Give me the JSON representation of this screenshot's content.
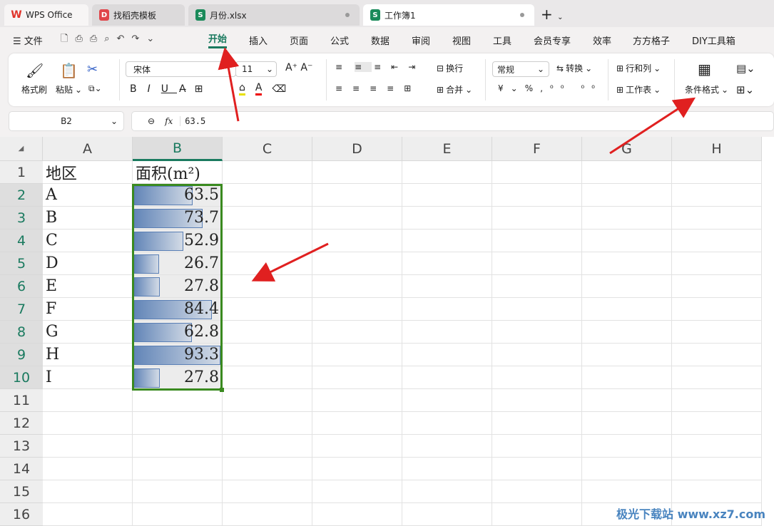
{
  "tabs": [
    {
      "label": "WPS Office"
    },
    {
      "label": "找稻壳模板"
    },
    {
      "label": "月份.xlsx"
    },
    {
      "label": "工作簿1"
    }
  ],
  "menu": {
    "file": "文件",
    "items": [
      "开始",
      "插入",
      "页面",
      "公式",
      "数据",
      "审阅",
      "视图",
      "工具",
      "会员专享",
      "效率",
      "方方格子",
      "DIY工具箱"
    ]
  },
  "ribbon": {
    "format_painter": "格式刷",
    "paste": "粘贴",
    "font": "宋体",
    "font_size": "11",
    "wrap": "换行",
    "merge": "合并",
    "number_format": "常规",
    "convert": "转换",
    "rows_cols": "行和列",
    "worksheet": "工作表",
    "cond_format": "条件格式"
  },
  "formula": {
    "cell_ref": "B2",
    "fx": "fx",
    "value": "63.5"
  },
  "columns": [
    "A",
    "B",
    "C",
    "D",
    "E",
    "F",
    "G",
    "H"
  ],
  "rows": [
    "1",
    "2",
    "3",
    "4",
    "5",
    "6",
    "7",
    "8",
    "9",
    "10",
    "11",
    "12",
    "13",
    "14",
    "15",
    "16"
  ],
  "header": {
    "a": "地区",
    "b": "面积(m²)"
  },
  "data": [
    {
      "region": "A",
      "area": "63.5",
      "v": 63.5
    },
    {
      "region": "B",
      "area": "73.7",
      "v": 73.7
    },
    {
      "region": "C",
      "area": "52.9",
      "v": 52.9
    },
    {
      "region": "D",
      "area": "26.7",
      "v": 26.7
    },
    {
      "region": "E",
      "area": "27.8",
      "v": 27.8
    },
    {
      "region": "F",
      "area": "84.4",
      "v": 84.4
    },
    {
      "region": "G",
      "area": "62.8",
      "v": 62.8
    },
    {
      "region": "H",
      "area": "93.3",
      "v": 93.3
    },
    {
      "region": "I",
      "area": "27.8",
      "v": 27.8
    }
  ],
  "watermark": "极光下载站 www.xz7.com",
  "colors": {
    "accent": "#1a7a5f",
    "selection": "#3a8a1f",
    "arrow": "#e02020"
  }
}
